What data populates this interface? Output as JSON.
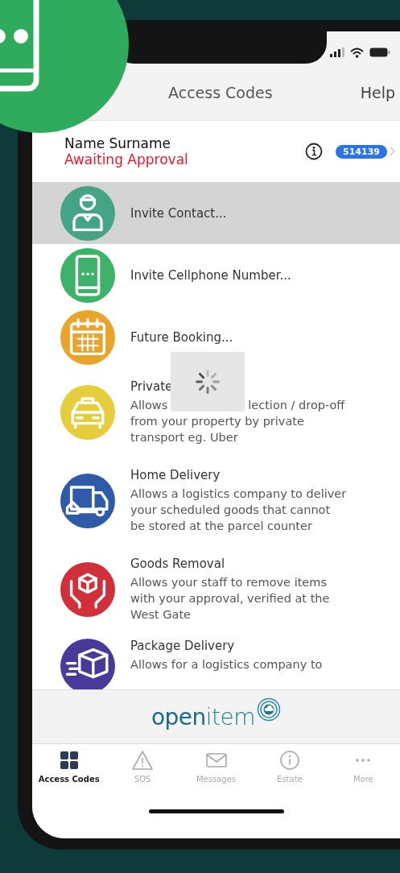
{
  "header": {
    "title": "Access Codes",
    "help": "Help"
  },
  "profile": {
    "name": "Name Surname",
    "status": "Awaiting Approval",
    "code": "514139"
  },
  "items": [
    {
      "title": "Invite Contact...",
      "color": "#45a486",
      "selected": true
    },
    {
      "title": "Invite Cellphone Number...",
      "color": "#3db36a",
      "selected": false
    },
    {
      "title": "Future Booking...",
      "color": "#e8a52a",
      "selected": false
    },
    {
      "title": "Private",
      "color": "#e5cd3c",
      "selected": false,
      "description": [
        [
          "Allows",
          "lection / drop-off"
        ],
        [
          "from your property by private"
        ],
        [
          "transport eg. Uber"
        ]
      ]
    },
    {
      "title": "Home Delivery",
      "color": "#2e5aa9",
      "selected": false,
      "description": [
        [
          "Allows a logistics company to deliver"
        ],
        [
          "your scheduled goods that cannot"
        ],
        [
          "be stored at the parcel counter"
        ]
      ]
    },
    {
      "title": "Goods Removal",
      "color": "#d1303a",
      "selected": false,
      "description": [
        [
          "Allows your staff to remove items"
        ],
        [
          "with your approval, verified at the"
        ],
        [
          "West Gate"
        ]
      ]
    },
    {
      "title": "Package Delivery",
      "color": "#48399b",
      "selected": false,
      "description": [
        [
          "Allows for a logistics company to"
        ]
      ]
    }
  ],
  "logo": "**open**item",
  "tabs": [
    {
      "label": "Access Codes",
      "selected": true
    },
    {
      "label": "SOS",
      "selected": false
    },
    {
      "label": "Messages",
      "selected": false
    },
    {
      "label": "Estate",
      "selected": false
    },
    {
      "label": "More",
      "selected": false
    }
  ]
}
